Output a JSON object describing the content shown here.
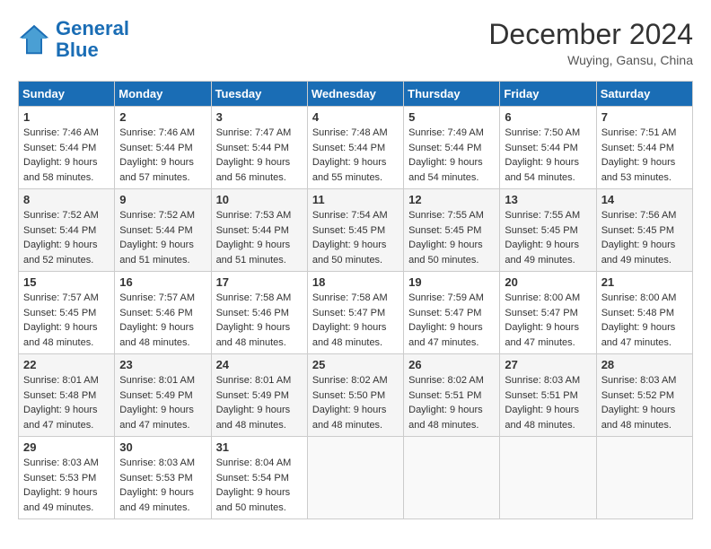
{
  "header": {
    "logo_line1": "General",
    "logo_line2": "Blue",
    "month": "December 2024",
    "location": "Wuying, Gansu, China"
  },
  "weekdays": [
    "Sunday",
    "Monday",
    "Tuesday",
    "Wednesday",
    "Thursday",
    "Friday",
    "Saturday"
  ],
  "weeks": [
    [
      {
        "day": 1,
        "sunrise": "7:46 AM",
        "sunset": "5:44 PM",
        "daylight": "9 hours and 58 minutes."
      },
      {
        "day": 2,
        "sunrise": "7:46 AM",
        "sunset": "5:44 PM",
        "daylight": "9 hours and 57 minutes."
      },
      {
        "day": 3,
        "sunrise": "7:47 AM",
        "sunset": "5:44 PM",
        "daylight": "9 hours and 56 minutes."
      },
      {
        "day": 4,
        "sunrise": "7:48 AM",
        "sunset": "5:44 PM",
        "daylight": "9 hours and 55 minutes."
      },
      {
        "day": 5,
        "sunrise": "7:49 AM",
        "sunset": "5:44 PM",
        "daylight": "9 hours and 54 minutes."
      },
      {
        "day": 6,
        "sunrise": "7:50 AM",
        "sunset": "5:44 PM",
        "daylight": "9 hours and 54 minutes."
      },
      {
        "day": 7,
        "sunrise": "7:51 AM",
        "sunset": "5:44 PM",
        "daylight": "9 hours and 53 minutes."
      }
    ],
    [
      {
        "day": 8,
        "sunrise": "7:52 AM",
        "sunset": "5:44 PM",
        "daylight": "9 hours and 52 minutes."
      },
      {
        "day": 9,
        "sunrise": "7:52 AM",
        "sunset": "5:44 PM",
        "daylight": "9 hours and 51 minutes."
      },
      {
        "day": 10,
        "sunrise": "7:53 AM",
        "sunset": "5:44 PM",
        "daylight": "9 hours and 51 minutes."
      },
      {
        "day": 11,
        "sunrise": "7:54 AM",
        "sunset": "5:45 PM",
        "daylight": "9 hours and 50 minutes."
      },
      {
        "day": 12,
        "sunrise": "7:55 AM",
        "sunset": "5:45 PM",
        "daylight": "9 hours and 50 minutes."
      },
      {
        "day": 13,
        "sunrise": "7:55 AM",
        "sunset": "5:45 PM",
        "daylight": "9 hours and 49 minutes."
      },
      {
        "day": 14,
        "sunrise": "7:56 AM",
        "sunset": "5:45 PM",
        "daylight": "9 hours and 49 minutes."
      }
    ],
    [
      {
        "day": 15,
        "sunrise": "7:57 AM",
        "sunset": "5:45 PM",
        "daylight": "9 hours and 48 minutes."
      },
      {
        "day": 16,
        "sunrise": "7:57 AM",
        "sunset": "5:46 PM",
        "daylight": "9 hours and 48 minutes."
      },
      {
        "day": 17,
        "sunrise": "7:58 AM",
        "sunset": "5:46 PM",
        "daylight": "9 hours and 48 minutes."
      },
      {
        "day": 18,
        "sunrise": "7:58 AM",
        "sunset": "5:47 PM",
        "daylight": "9 hours and 48 minutes."
      },
      {
        "day": 19,
        "sunrise": "7:59 AM",
        "sunset": "5:47 PM",
        "daylight": "9 hours and 47 minutes."
      },
      {
        "day": 20,
        "sunrise": "8:00 AM",
        "sunset": "5:47 PM",
        "daylight": "9 hours and 47 minutes."
      },
      {
        "day": 21,
        "sunrise": "8:00 AM",
        "sunset": "5:48 PM",
        "daylight": "9 hours and 47 minutes."
      }
    ],
    [
      {
        "day": 22,
        "sunrise": "8:01 AM",
        "sunset": "5:48 PM",
        "daylight": "9 hours and 47 minutes."
      },
      {
        "day": 23,
        "sunrise": "8:01 AM",
        "sunset": "5:49 PM",
        "daylight": "9 hours and 47 minutes."
      },
      {
        "day": 24,
        "sunrise": "8:01 AM",
        "sunset": "5:49 PM",
        "daylight": "9 hours and 48 minutes."
      },
      {
        "day": 25,
        "sunrise": "8:02 AM",
        "sunset": "5:50 PM",
        "daylight": "9 hours and 48 minutes."
      },
      {
        "day": 26,
        "sunrise": "8:02 AM",
        "sunset": "5:51 PM",
        "daylight": "9 hours and 48 minutes."
      },
      {
        "day": 27,
        "sunrise": "8:03 AM",
        "sunset": "5:51 PM",
        "daylight": "9 hours and 48 minutes."
      },
      {
        "day": 28,
        "sunrise": "8:03 AM",
        "sunset": "5:52 PM",
        "daylight": "9 hours and 48 minutes."
      }
    ],
    [
      {
        "day": 29,
        "sunrise": "8:03 AM",
        "sunset": "5:53 PM",
        "daylight": "9 hours and 49 minutes."
      },
      {
        "day": 30,
        "sunrise": "8:03 AM",
        "sunset": "5:53 PM",
        "daylight": "9 hours and 49 minutes."
      },
      {
        "day": 31,
        "sunrise": "8:04 AM",
        "sunset": "5:54 PM",
        "daylight": "9 hours and 50 minutes."
      },
      null,
      null,
      null,
      null
    ]
  ]
}
